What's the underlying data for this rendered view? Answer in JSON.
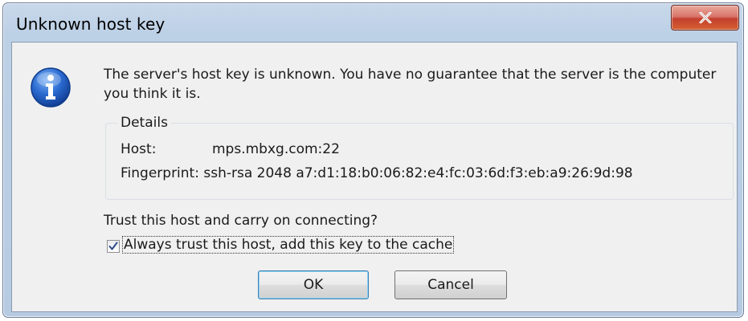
{
  "dialog": {
    "title": "Unknown host key",
    "close_icon": "close-x-icon",
    "info_icon": "information-icon",
    "message": "The server's host key is unknown. You have no guarantee that the server is the computer you think it is.",
    "details": {
      "legend": "Details",
      "host_label": "Host:",
      "host_value": "mps.mbxg.com:22",
      "fingerprint_label": "Fingerprint:",
      "fingerprint_value": "ssh-rsa 2048 a7:d1:18:b0:06:82:e4:fc:03:6d:f3:eb:a9:26:9d:98"
    },
    "question": "Trust this host and carry on connecting?",
    "always_trust": {
      "label": "Always trust this host, add this key to the cache",
      "checked": true
    },
    "ok_label": "OK",
    "cancel_label": "Cancel"
  },
  "colors": {
    "frame": "#bcd0e6",
    "close_button": "#c4402f",
    "info_icon": "#2a6ad0",
    "client_bg": "#f0f0f0"
  }
}
